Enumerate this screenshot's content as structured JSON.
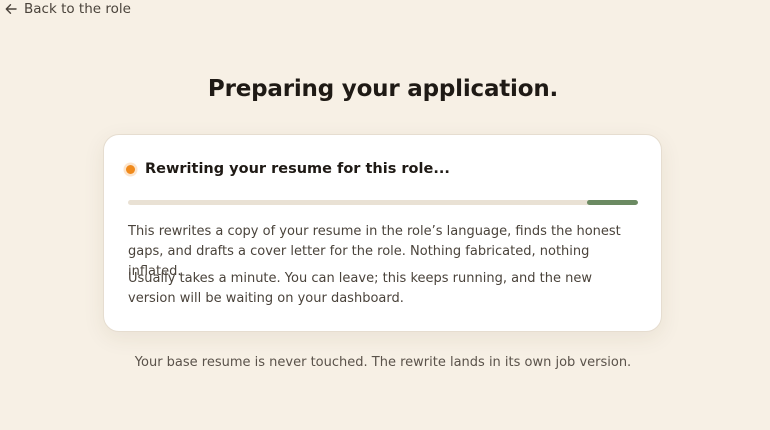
{
  "nav": {
    "back_label": "Back to the role",
    "back_icon": "arrow-left-icon"
  },
  "headline": "Preparing your application.",
  "card": {
    "status_text": "Rewriting your resume for this role...",
    "status_color": "#f08a1c",
    "progress": {
      "value_start_fraction": 0.9,
      "value_end_fraction": 1.0,
      "fill_color": "#6b8a62",
      "track_color": "#e9e1d4"
    },
    "description": "This rewrites a copy of your resume in the role’s language, finds the honest gaps, and drafts a cover letter for the role. Nothing fabricated, nothing inflated.",
    "timing_note": "Usually takes a minute. You can leave; this keeps running, and the new version will be waiting on your dashboard."
  },
  "footnote": "Your base resume is never touched. The rewrite lands in its own job version."
}
